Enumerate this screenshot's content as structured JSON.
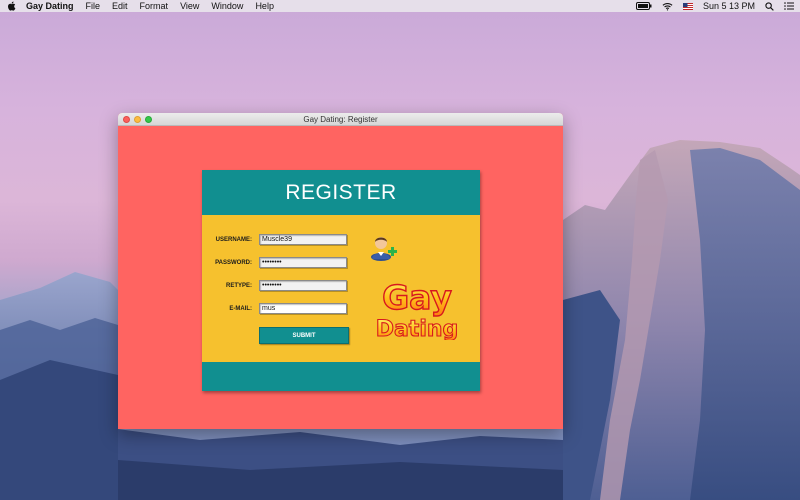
{
  "menubar": {
    "app_name": "Gay Dating",
    "items": [
      "File",
      "Edit",
      "Format",
      "View",
      "Window",
      "Help"
    ],
    "clock": "Sun 5 13 PM"
  },
  "window": {
    "title": "Gay Dating: Register"
  },
  "form": {
    "heading": "REGISTER",
    "fields": [
      {
        "label": "USERNAME:",
        "value": "Muscle39"
      },
      {
        "label": "PASSWORD:",
        "value": "••••••••"
      },
      {
        "label": "RETYPE:",
        "value": "••••••••"
      },
      {
        "label": "E-MAIL:",
        "value": "mus"
      }
    ],
    "submit_label": "SUBMIT"
  },
  "logo": {
    "line1": "Gay",
    "line2": "Dating"
  },
  "colors": {
    "window_bg": "#ff6461",
    "panel_bg": "#f6c12e",
    "teal": "#118f90"
  }
}
